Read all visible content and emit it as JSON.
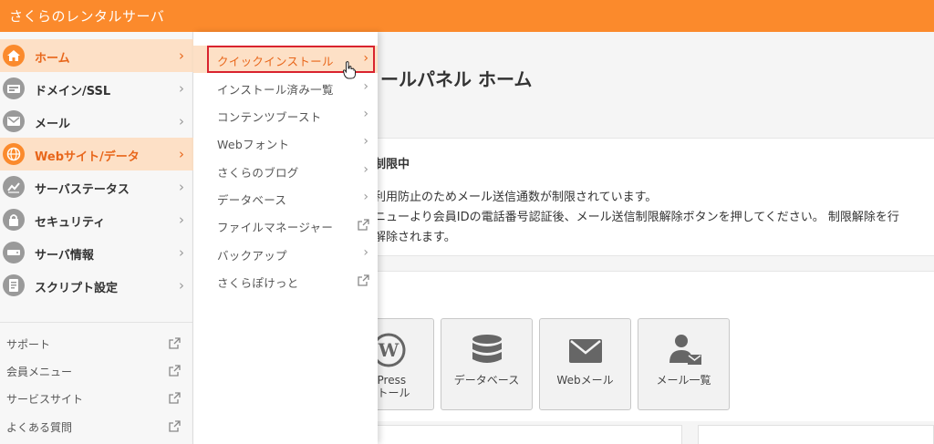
{
  "header": {
    "title": "さくらのレンタルサーバ"
  },
  "main": {
    "page_title": "ールパネル ホーム",
    "notice": {
      "title": "信制限中",
      "line1": "正利用防止のためメール送信通数が制限されています。",
      "line2": "メニューより会員IDの電話番号認証後、メール送信制限解除ボタンを押してください。 制限解除を行",
      "line3": "で解除されます。"
    },
    "tiles": [
      {
        "label": "dPress",
        "label2": "ストール",
        "icon": "wordpress-icon"
      },
      {
        "label": "データベース",
        "label2": "",
        "icon": "database-icon"
      },
      {
        "label": "Webメール",
        "label2": "",
        "icon": "mail-icon"
      },
      {
        "label": "メール一覧",
        "label2": "",
        "icon": "user-mail-icon"
      }
    ]
  },
  "sidebar": {
    "items": [
      {
        "label": "ホーム",
        "icon": "home-icon"
      },
      {
        "label": "ドメイン/SSL",
        "icon": "domain-icon"
      },
      {
        "label": "メール",
        "icon": "mail-icon"
      },
      {
        "label": "Webサイト/データ",
        "icon": "globe-icon"
      },
      {
        "label": "サーバステータス",
        "icon": "chart-icon"
      },
      {
        "label": "セキュリティ",
        "icon": "lock-icon"
      },
      {
        "label": "サーバ情報",
        "icon": "server-icon"
      },
      {
        "label": "スクリプト設定",
        "icon": "script-icon"
      }
    ],
    "links": [
      {
        "label": "サポート"
      },
      {
        "label": "会員メニュー"
      },
      {
        "label": "サービスサイト"
      },
      {
        "label": "よくある質問"
      }
    ]
  },
  "flyout": {
    "items": [
      {
        "label": "クイックインストール",
        "type": "submenu"
      },
      {
        "label": "インストール済み一覧",
        "type": "submenu"
      },
      {
        "label": "コンテンツブースト",
        "type": "submenu"
      },
      {
        "label": "Webフォント",
        "type": "submenu"
      },
      {
        "label": "さくらのブログ",
        "type": "submenu"
      },
      {
        "label": "データベース",
        "type": "submenu"
      },
      {
        "label": "ファイルマネージャー",
        "type": "external"
      },
      {
        "label": "バックアップ",
        "type": "submenu"
      },
      {
        "label": "さくらぽけっと",
        "type": "external"
      }
    ]
  },
  "colors": {
    "accent": "#fb8a2c",
    "highlight": "#fde0c6",
    "active_text": "#e8661a",
    "outline": "#d9232e"
  }
}
